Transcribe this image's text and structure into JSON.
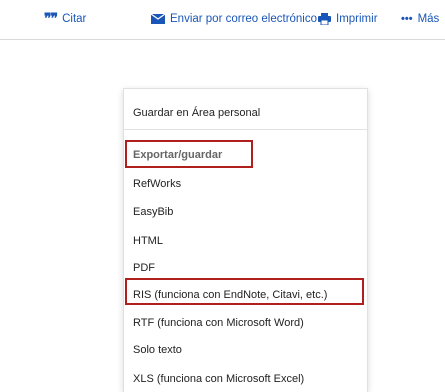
{
  "toolbar": {
    "cite_label": "Citar",
    "cite_icon": "quote-icon",
    "email_label": "Enviar por correo electrónico",
    "email_icon": "envelope-icon",
    "print_label": "Imprimir",
    "print_icon": "printer-icon",
    "more_label": "Más",
    "more_icon": "ellipsis-icon",
    "link_color": "#1a56b8"
  },
  "menu": {
    "save_personal": "Guardar en Área personal",
    "export_heading": "Exportar/guardar",
    "items": [
      "RefWorks",
      "EasyBib",
      "HTML",
      "PDF",
      "RIS (funciona con EndNote, Citavi, etc.)",
      "RTF (funciona con Microsoft Word)",
      "Solo texto",
      "XLS (funciona con Microsoft Excel)"
    ],
    "highlight_color": "#b01e1e"
  }
}
